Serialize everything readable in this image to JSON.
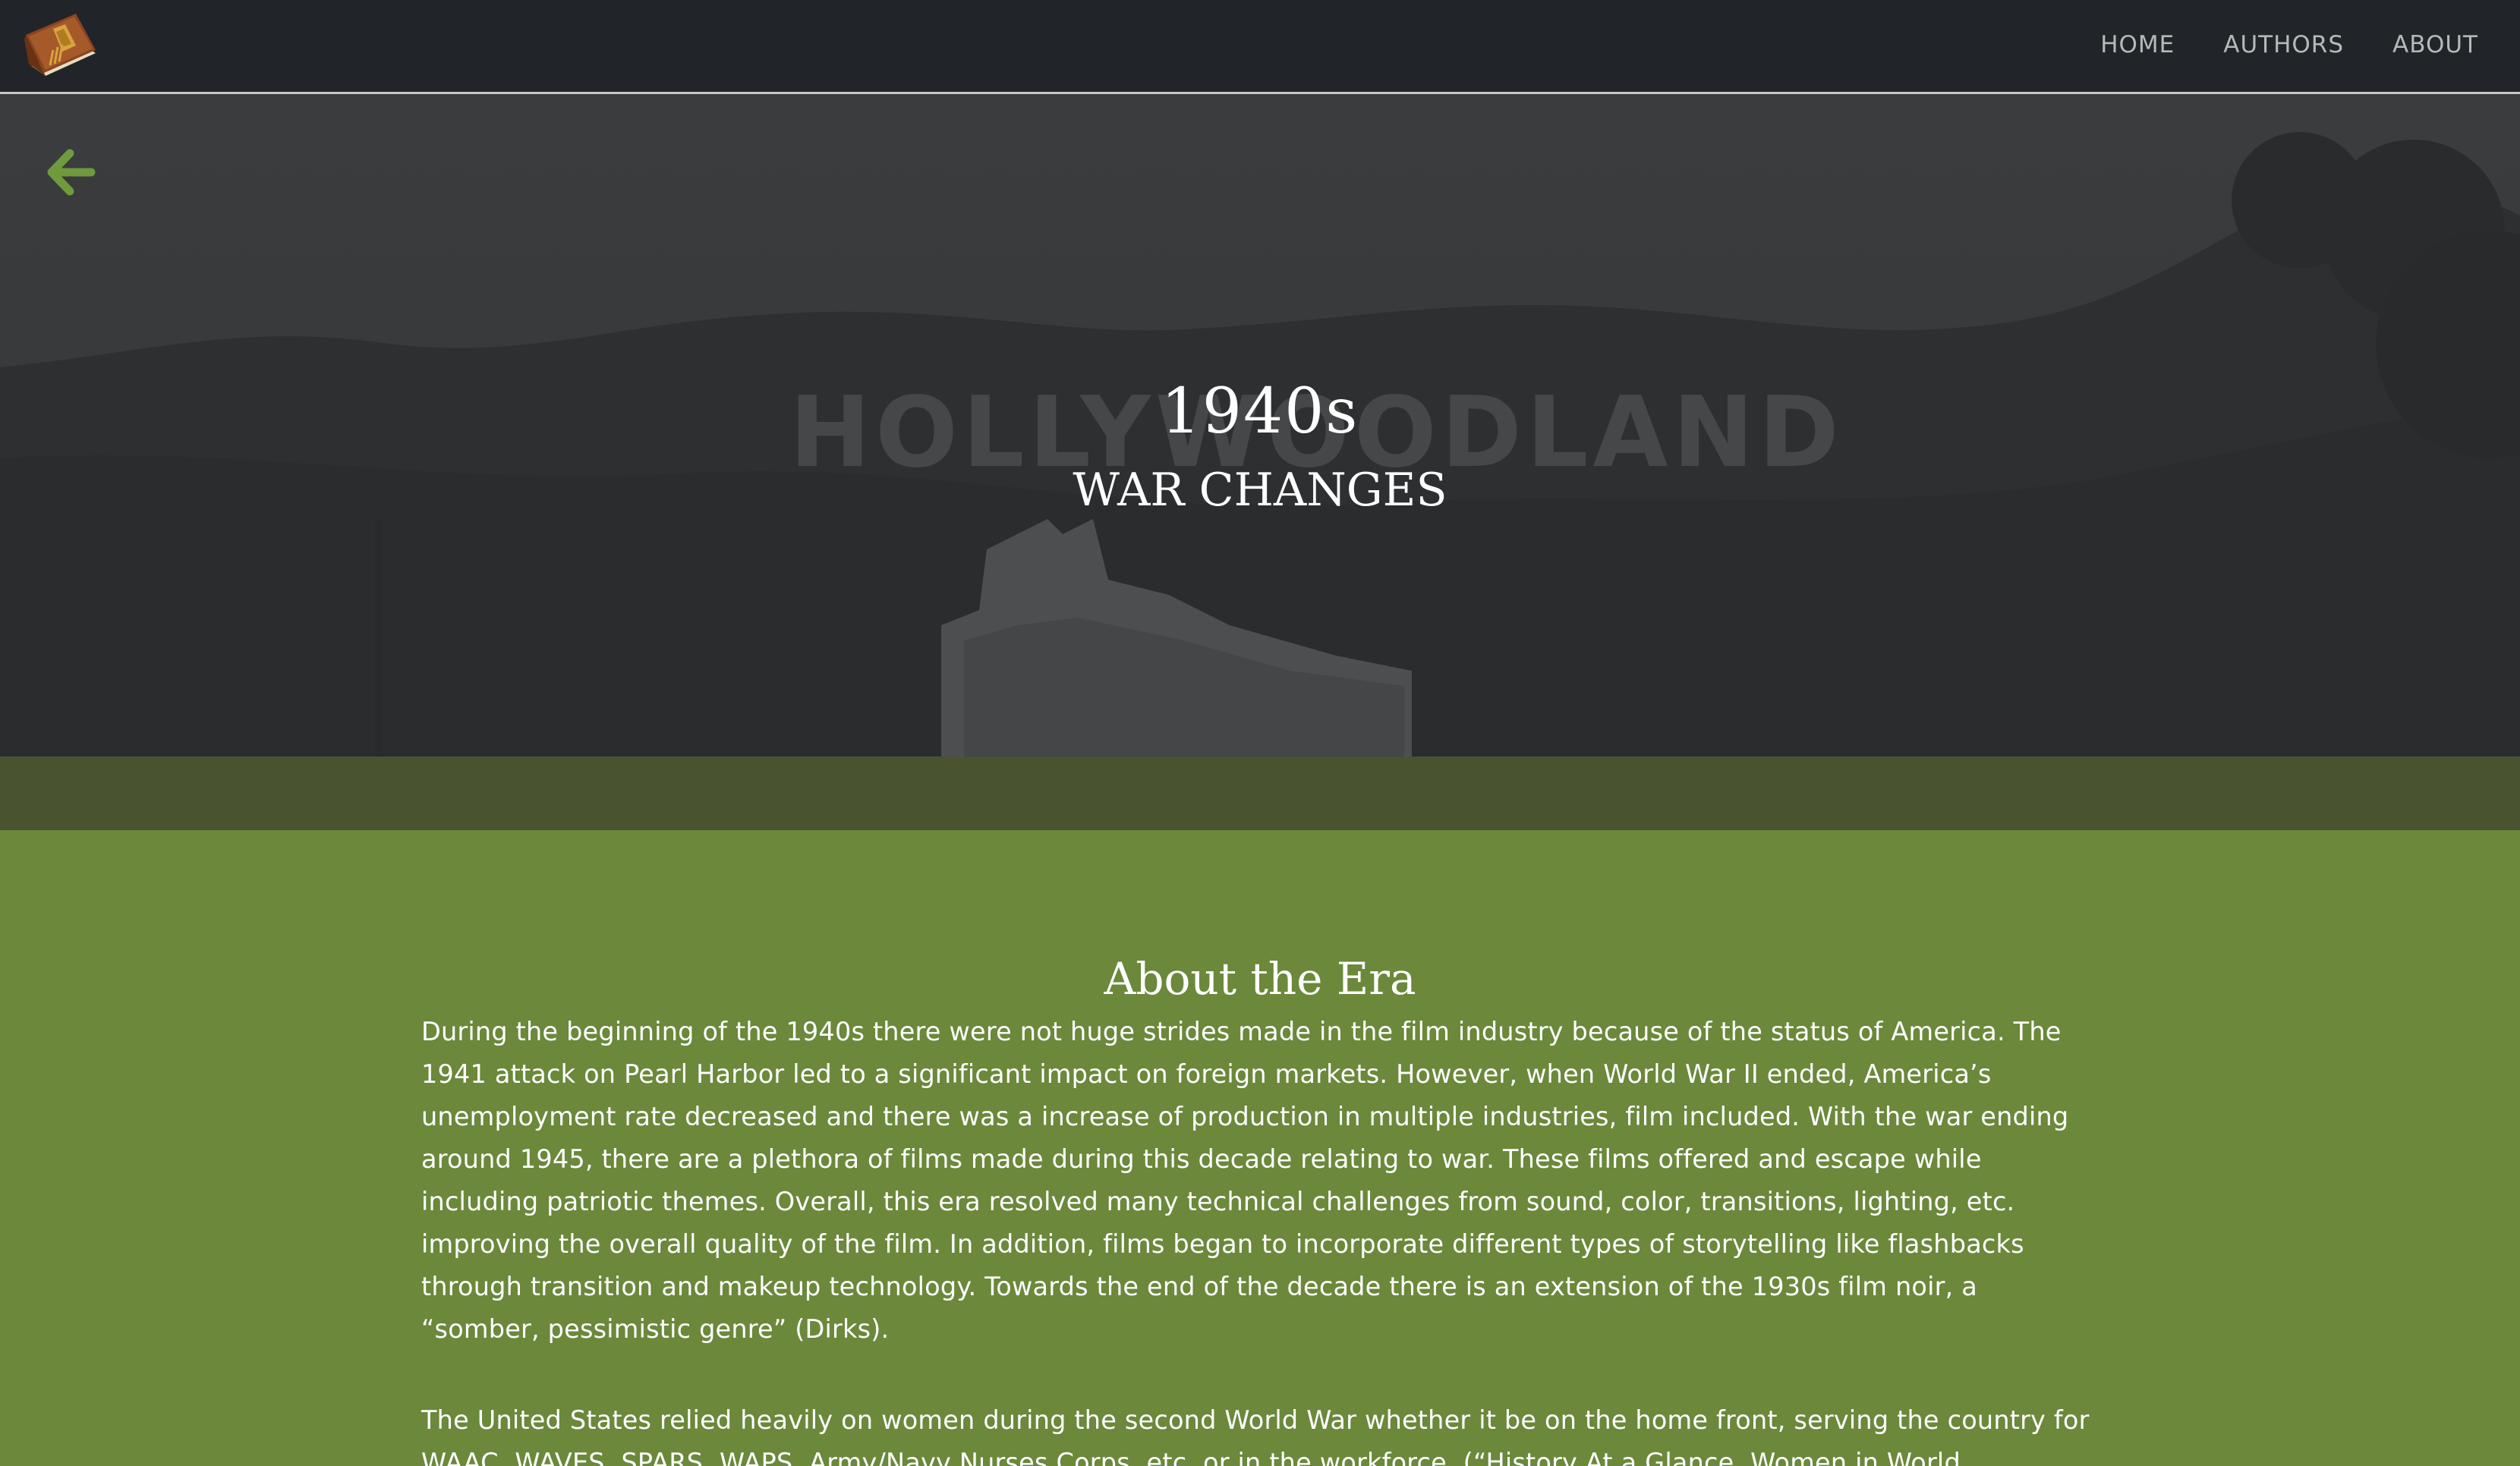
{
  "nav": {
    "brand_icon": "book-icon",
    "links": [
      "HOME",
      "AUTHORS",
      "ABOUT"
    ]
  },
  "hero": {
    "back_icon": "arrow-left-icon",
    "title": "1940s",
    "subtitle": "WAR CHANGES",
    "sign_text": "HOLLYWOODLAND"
  },
  "about": {
    "heading": "About the Era",
    "paragraphs": [
      "During the beginning of the 1940s there were not huge strides made in the film industry because of the status of America. The 1941 attack on Pearl Harbor led to a significant impact on foreign markets. However, when World War II ended, America’s unemployment rate decreased and there was a increase of production in multiple industries, film included. With the war ending around 1945, there are a plethora of films made during this decade relating to war. These films offered and escape while including patriotic themes. Overall, this era resolved many technical challenges from sound, color, transitions, lighting, etc. improving the overall quality of the film. In addition, films began to incorporate different types of storytelling like flashbacks through transition and makeup technology. Towards the end of the decade there is an extension of the 1930s film noir, a “somber, pessimistic genre” (Dirks).",
      "The United States relied heavily on women during the second World War whether it be on the home front, serving the country for WAAC, WAVES, SPARS, WAPS, Army/Navy Nurses Corps, etc. or in the workforce. (“History At a Glance, Women in World"
    ]
  },
  "colors": {
    "navbar": "#212529",
    "accent_green": "#6b883b",
    "arrow_green": "#6f9a3e",
    "nav_text": "#b6b8ba"
  }
}
